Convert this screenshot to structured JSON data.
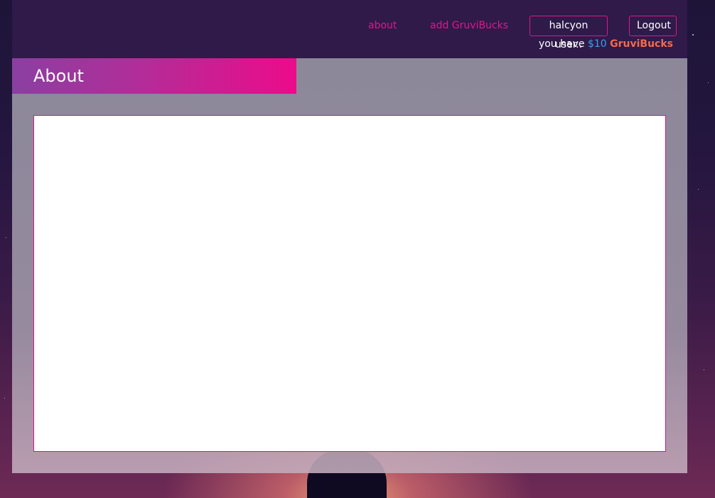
{
  "nav": {
    "links": [
      "about",
      "add GruviBucks"
    ],
    "user_button": "halcyon user..",
    "logout_button": "Logout",
    "balance": {
      "prefix": "you have",
      "amount": "$10",
      "currency": "GruviBucks"
    }
  },
  "page": {
    "title": "About"
  },
  "colors": {
    "accent_pink": "#e0168c",
    "nav_bg": "#2f1a4a",
    "amount_blue": "#3aa0f2",
    "currency_orange": "#f46a4c"
  }
}
